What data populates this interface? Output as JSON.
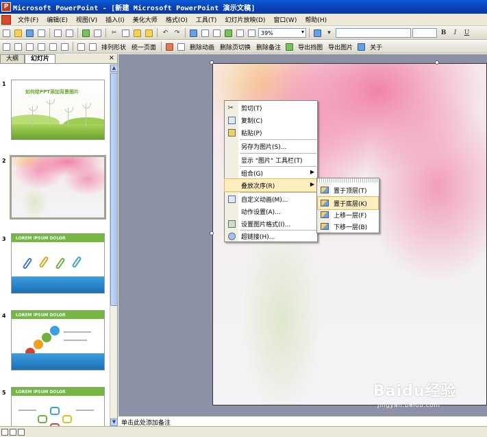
{
  "window": {
    "title": "Microsoft PowerPoint - [新建 Microsoft PowerPoint 演示文稿]"
  },
  "menu": [
    "文件(F)",
    "编辑(E)",
    "视图(V)",
    "插入(I)",
    "美化大师",
    "格式(O)",
    "工具(T)",
    "幻灯片放映(D)",
    "窗口(W)",
    "帮助(H)"
  ],
  "toolbar1": {
    "zoom": "39%"
  },
  "toolbar2": {
    "labels": [
      "排列形状",
      "统一页面",
      "删除动画",
      "删除页切换",
      "删除备注",
      "导出挡图",
      "导出图片",
      "关于"
    ]
  },
  "panel": {
    "tabs": [
      "大纲",
      "幻灯片"
    ],
    "close": "×"
  },
  "slides": [
    {
      "number": "1",
      "title": "如何给PPT添加背景图片"
    },
    {
      "number": "2"
    },
    {
      "number": "3",
      "header": "LOREM IPSUM DOLOR"
    },
    {
      "number": "4",
      "header": "LOREM IPSUM DOLOR"
    },
    {
      "number": "5",
      "header": "LOREM IPSUM DOLOR"
    }
  ],
  "context_menu": {
    "items": [
      {
        "label": "剪切(T)",
        "icon": "scissors-icon"
      },
      {
        "label": "复制(C)",
        "icon": "copy-icon"
      },
      {
        "label": "粘贴(P)",
        "icon": "paste-icon"
      },
      {
        "label": "另存为图片(S)...",
        "icon": ""
      },
      {
        "label": "显示 \"图片\" 工具栏(T)",
        "icon": ""
      },
      {
        "label": "组合(G)",
        "icon": "",
        "submenu": true
      },
      {
        "label": "叠放次序(R)",
        "icon": "",
        "submenu": true,
        "highlighted": true
      },
      {
        "label": "自定义动画(M)...",
        "icon": "custom-animation-icon"
      },
      {
        "label": "动作设置(A)...",
        "icon": ""
      },
      {
        "label": "设置图片格式(I)...",
        "icon": "format-picture-icon"
      },
      {
        "label": "超链接(H)...",
        "icon": "hyperlink-icon"
      }
    ]
  },
  "submenu": {
    "items": [
      {
        "label": "置于顶层(T)"
      },
      {
        "label": "置于底层(K)",
        "highlighted": true
      },
      {
        "label": "上移一层(F)"
      },
      {
        "label": "下移一层(B)"
      }
    ]
  },
  "notes": {
    "placeholder": "单击此处添加备注"
  },
  "watermark": {
    "brand": "Baidu经验",
    "url": "jingyan.baidu.com"
  },
  "colors": {
    "titlebar": "#0a47c4",
    "menu_highlight": "#fdeec0",
    "workspace": "#8c91a6",
    "template_green": "#74b742",
    "template_blue": "#1c6fb4"
  }
}
